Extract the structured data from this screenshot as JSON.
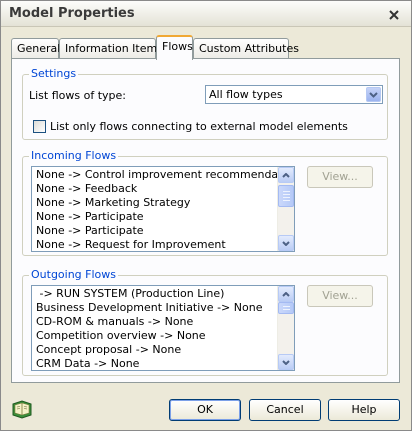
{
  "window": {
    "title": "Model Properties"
  },
  "tabs": [
    {
      "label": "General",
      "active": false
    },
    {
      "label": "Information Items",
      "active": false
    },
    {
      "label": "Flows",
      "active": true
    },
    {
      "label": "Custom Attributes",
      "active": false
    }
  ],
  "settings": {
    "legend": "Settings",
    "list_flows_label": "List flows of type:",
    "flow_type_value": "All flow types",
    "checkbox_label": "List only flows connecting to external model elements",
    "checkbox_checked": false
  },
  "incoming": {
    "legend": "Incoming Flows",
    "items": [
      "None -> Control improvement recommendation",
      "None -> Feedback",
      "None -> Marketing Strategy",
      "None -> Participate",
      "None -> Participate",
      "None -> Request for Improvement"
    ],
    "view_label": "View..."
  },
  "outgoing": {
    "legend": "Outgoing Flows",
    "items": [
      " -> RUN SYSTEM (Production Line)",
      "Business Development Initiative -> None",
      "CD-ROM & manuals -> None",
      "Competition overview -> None",
      "Concept proposal -> None",
      "CRM Data -> None"
    ],
    "view_label": "View..."
  },
  "footer": {
    "ok_label": "OK",
    "cancel_label": "Cancel",
    "help_label": "Help"
  },
  "colors": {
    "accent_tab": "#f0a834",
    "legend_blue": "#0046d5",
    "dialog_bg": "#ECE9D8"
  }
}
